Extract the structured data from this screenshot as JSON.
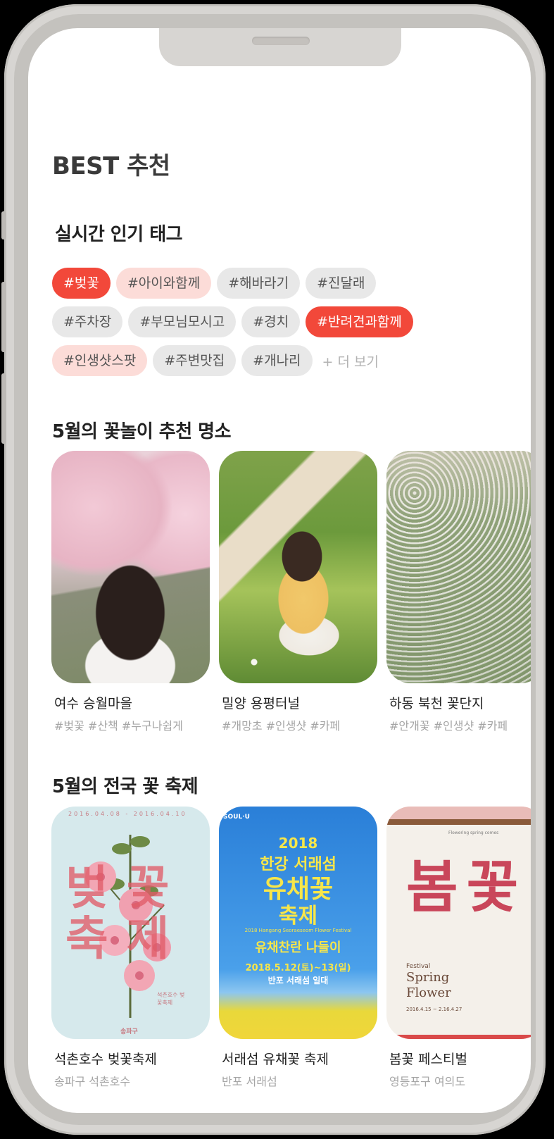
{
  "header": {
    "title": "BEST 추천"
  },
  "tags_section": {
    "title": "실시간 인기 태그",
    "rows": [
      [
        {
          "label": "#벚꽃",
          "style": "hot"
        },
        {
          "label": "#아이와함께",
          "style": "warm"
        },
        {
          "label": "#해바라기",
          "style": "normal"
        },
        {
          "label": "#진달래",
          "style": "normal"
        }
      ],
      [
        {
          "label": "#주차장",
          "style": "normal"
        },
        {
          "label": "#부모님모시고",
          "style": "normal"
        },
        {
          "label": "#경치",
          "style": "normal"
        },
        {
          "label": "#반려견과함께",
          "style": "hot"
        }
      ],
      [
        {
          "label": "#인생샷스팟",
          "style": "warm"
        },
        {
          "label": "#주변맛집",
          "style": "normal"
        },
        {
          "label": "#개나리",
          "style": "normal"
        }
      ]
    ],
    "more_label": "+ 더 보기"
  },
  "spots_section": {
    "title": "5월의 꽃놀이 추천 명소",
    "cards": [
      {
        "title": "여수 승월마을",
        "tags": "#벚꽃 #산책 #누구나쉽게",
        "image": "cherry-blossom-path-photo"
      },
      {
        "title": "밀양 용평터널",
        "tags": "#개망초 #인생샷 #카페",
        "image": "daisy-field-photo"
      },
      {
        "title": "하동 북천 꽃단지",
        "tags": "#안개꽃 #인생샷 #카페",
        "image": "buckwheat-field-photo"
      }
    ]
  },
  "festival_section": {
    "title": "5월의 전국 꽃 축제",
    "cards": [
      {
        "title": "석촌호수 벚꽃축제",
        "sub": "송파구 석촌호수",
        "image": "cherry-festival-poster"
      },
      {
        "title": "서래섬 유채꽃 축제",
        "sub": "반포 서래섬",
        "image": "canola-festival-poster"
      },
      {
        "title": "봄꽃 페스티벌",
        "sub": "영등포구 여의도",
        "image": "spring-flower-poster"
      }
    ],
    "posters": {
      "p1_dates": "2016.04.08 - 2016.04.10",
      "p1_big": "벚꽃축제",
      "p1_small": "석촌호수 벚꽃축제",
      "p1_org": "송파구",
      "p2_brand": "SOUL·U",
      "p2_year": "2018",
      "p2_line1": "한강 서래섬",
      "p2_line2": "유채꽃",
      "p2_line3": "축제",
      "p2_sub": "2018 Hangang Seoraeseom Flower Festival",
      "p2_slogan": "유채찬란 나들이",
      "p2_date": "2018.5.12(토)~13(일)",
      "p2_place": "반포 서래섬 일대",
      "p3_top": "Flowering spring comes",
      "p3_big": "봄꽃",
      "p3_festival": "Festival",
      "p3_title": "Spring Flower",
      "p3_date": "2016.4.15 ~ 2.16.4.27"
    }
  },
  "colors": {
    "accent": "#f2483a",
    "accent_soft": "#fcdcd8",
    "chip_gray": "#e8e8e8",
    "muted_text": "#a5a5a5"
  }
}
